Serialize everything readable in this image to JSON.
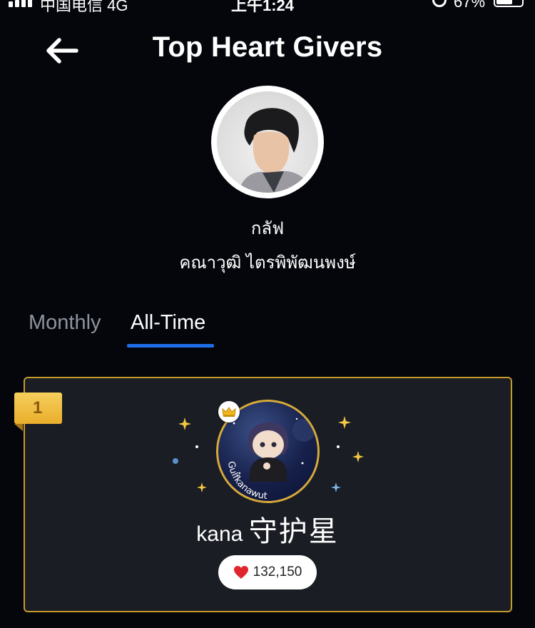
{
  "status_bar": {
    "carrier": "中国电信  4G",
    "time": "上午1:24",
    "battery": "67%"
  },
  "header": {
    "title": "Top Heart Givers",
    "back_icon": "back-arrow-icon"
  },
  "profile": {
    "nickname": "กลัฟ",
    "full_name": "คณาวุฒิ ไตรพิพัฒนพงษ์"
  },
  "tabs": [
    {
      "label": "Monthly",
      "active": false
    },
    {
      "label": "All-Time",
      "active": true
    }
  ],
  "leaderboard": [
    {
      "rank": "1",
      "name_latin": "kana",
      "name_cjk": "守护星",
      "hearts": "132,150",
      "avatar_text": "Gulfkanawut",
      "badge_icon": "crown-icon"
    }
  ],
  "colors": {
    "background": "#04060c",
    "card": "#1a1d23",
    "card_border": "#c79a2c",
    "tab_underline": "#1f6ee8",
    "rank_badge": "#efbd43",
    "heart": "#e0252d"
  }
}
